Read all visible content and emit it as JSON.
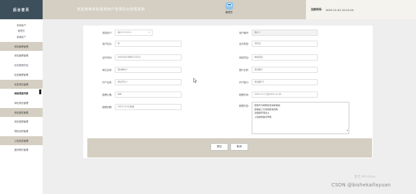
{
  "header": {
    "brand": "后台首页",
    "site_title": "欢迎使用体检系统用户登录后台管理系统",
    "admin_label": "管理员",
    "time_label": "当前时间:",
    "time_value": "2023-12-02 10:12:04"
  },
  "sidebar": {
    "items": [
      {
        "label": "系统用户"
      },
      {
        "label": "管理员"
      },
      {
        "label": "普通用户"
      },
      {
        "label": "体检套餐管理"
      },
      {
        "label": "体检套餐管理"
      },
      {
        "label": "检查套餐药品"
      },
      {
        "label": "检查套餐管理"
      },
      {
        "label": "检查项目管理"
      },
      {
        "label": "体检项目列表"
      },
      {
        "label": "体检项目管理"
      },
      {
        "label": "体检报告管理"
      },
      {
        "label": "体检视频管理"
      },
      {
        "label": "预检安排管理"
      },
      {
        "label": "公告信息管理"
      },
      {
        "label": "团体预约管理"
      }
    ]
  },
  "form": {
    "left": [
      {
        "label": "体检用户:",
        "value": "用户1111111",
        "caret": "▾"
      },
      {
        "label": "用户姓名:",
        "value": "张"
      },
      {
        "label": "证件号码:",
        "value": "44444419880123123"
      },
      {
        "label": "单位名称:",
        "value": "测试单位1"
      },
      {
        "label": "开户名称:",
        "value": "测试开户1"
      },
      {
        "label": "套餐价格:",
        "value": "888"
      },
      {
        "label": "套餐到期:",
        "value": "2023-12-02套餐"
      }
    ],
    "right": [
      {
        "label": "用户编号:",
        "value": "用户1"
      },
      {
        "label": "证件类型:",
        "value": "身份证"
      },
      {
        "label": "体检项目:",
        "value": "体检项目"
      },
      {
        "label": "银行名称:",
        "value": "测试银行"
      },
      {
        "label": "开户银行:",
        "value": "测试银行1"
      },
      {
        "label": "套餐时间:",
        "value": "2023-12-17至2023-11-30"
      },
      {
        "label": "套餐内容:",
        "value": ""
      }
    ],
    "textarea_lines": [
      "套餐专为肺部检查提前准备，",
      "套餐前三天停用其他药物",
      "忌烟酒辛辣生冷",
      "上班前准备好早餐"
    ],
    "resize_glyph": "◢"
  },
  "actions": {
    "submit": "提交",
    "cancel": "取消"
  },
  "watermarks": {
    "windows": "激活 Windows",
    "csdn": "CSDN @bishekaifayuan"
  }
}
